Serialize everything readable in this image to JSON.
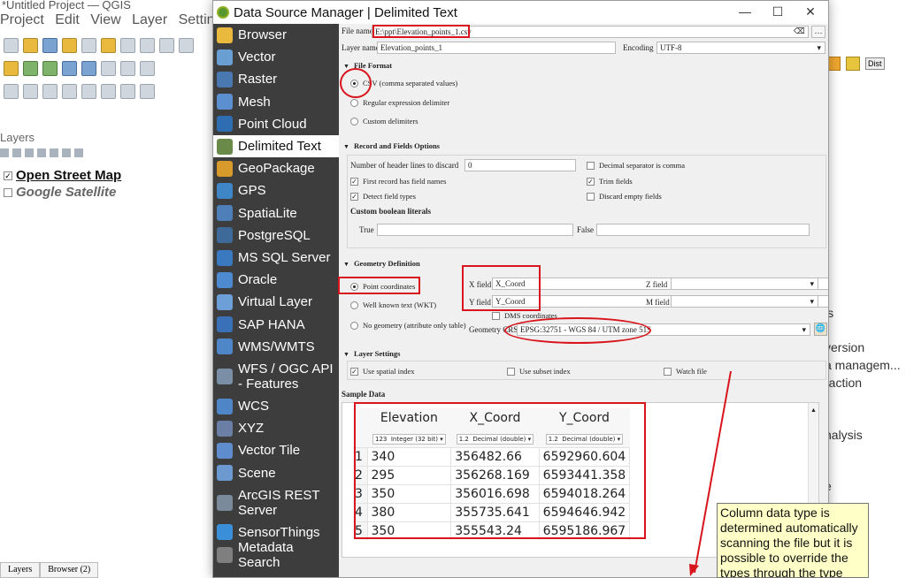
{
  "qgis": {
    "title": "*Untitled Project — QGIS",
    "menu": [
      "Project",
      "Edit",
      "View",
      "Layer",
      "Settings"
    ],
    "layers_panel_title": "Layers",
    "layers": [
      {
        "name": "Open Street Map",
        "checked": true
      },
      {
        "name": "Google Satellite",
        "checked": false
      }
    ],
    "bottom_tabs": [
      "Layers",
      "Browser (2)"
    ],
    "right_fragments": [
      "is",
      "version",
      "a managem...",
      "raction",
      "nalysis",
      "e"
    ],
    "right_toolbar_text": "Dist"
  },
  "dialog": {
    "title": "Data Source Manager | Delimited Text",
    "controls": {
      "minimize": "—",
      "maximize": "☐",
      "close": "✕"
    },
    "sidebar": [
      {
        "label": "Browser",
        "icon": "browser-icon",
        "color": "#e8b93d"
      },
      {
        "label": "Vector",
        "icon": "vector-icon",
        "color": "#6a9fd4"
      },
      {
        "label": "Raster",
        "icon": "raster-icon",
        "color": "#4a78b0"
      },
      {
        "label": "Mesh",
        "icon": "mesh-icon",
        "color": "#5b8fcf"
      },
      {
        "label": "Point Cloud",
        "icon": "point-cloud-icon",
        "color": "#2f6db3"
      },
      {
        "label": "Delimited Text",
        "icon": "delimited-text-icon",
        "color": "#6a8a4a"
      },
      {
        "label": "GeoPackage",
        "icon": "geopackage-icon",
        "color": "#d89a2a"
      },
      {
        "label": "GPS",
        "icon": "gps-icon",
        "color": "#3e86c6"
      },
      {
        "label": "SpatiaLite",
        "icon": "spatialite-icon",
        "color": "#4e7fb8"
      },
      {
        "label": "PostgreSQL",
        "icon": "postgresql-icon",
        "color": "#3d6a99"
      },
      {
        "label": "MS SQL Server",
        "icon": "mssql-icon",
        "color": "#3a78c0"
      },
      {
        "label": "Oracle",
        "icon": "oracle-icon",
        "color": "#4d8ad0"
      },
      {
        "label": "Virtual Layer",
        "icon": "virtual-layer-icon",
        "color": "#6c9fd8"
      },
      {
        "label": "SAP HANA",
        "icon": "sap-hana-icon",
        "color": "#3a70b8"
      },
      {
        "label": "WMS/WMTS",
        "icon": "wms-icon",
        "color": "#4e86c8"
      },
      {
        "label": "WFS / OGC API - Features",
        "icon": "wfs-icon",
        "color": "#7a8fa6"
      },
      {
        "label": "WCS",
        "icon": "wcs-icon",
        "color": "#4e86c8"
      },
      {
        "label": "XYZ",
        "icon": "xyz-icon",
        "color": "#6b7fa6"
      },
      {
        "label": "Vector Tile",
        "icon": "vector-tile-icon",
        "color": "#5f8ccc"
      },
      {
        "label": "Scene",
        "icon": "scene-icon",
        "color": "#6c9ad0"
      },
      {
        "label": "ArcGIS REST Server",
        "icon": "arcgis-icon",
        "color": "#7a8a9a"
      },
      {
        "label": "SensorThings",
        "icon": "sensorthings-icon",
        "color": "#3b8fd8"
      },
      {
        "label": "Metadata Search",
        "icon": "metadata-search-icon",
        "color": "#7f7f7f"
      }
    ],
    "file_name_label": "File name",
    "file_name_value": "E:\\ppt\\Elevation_points_1.csv",
    "browse_label": "…",
    "layer_name_label": "Layer name",
    "layer_name_value": "Elevation_points_1",
    "encoding_label": "Encoding",
    "encoding_value": "UTF-8",
    "file_format": {
      "title": "File Format",
      "options": [
        "CSV (comma separated values)",
        "Regular expression delimiter",
        "Custom delimiters"
      ],
      "selected": 0
    },
    "record_fields": {
      "title": "Record and Fields Options",
      "header_lines_label": "Number of header lines to discard",
      "header_lines_value": "0",
      "decimal_comma_label": "Decimal separator is comma",
      "first_record_label": "First record has field names",
      "trim_fields_label": "Trim fields",
      "detect_types_label": "Detect field types",
      "discard_empty_label": "Discard empty fields",
      "custom_boolean_label": "Custom boolean literals",
      "true_label": "True",
      "false_label": "False"
    },
    "geometry": {
      "title": "Geometry Definition",
      "options": [
        "Point coordinates",
        "Well known text (WKT)",
        "No geometry (attribute only table)"
      ],
      "selected": 0,
      "x_field_label": "X field",
      "x_field_value": "X_Coord",
      "y_field_label": "Y field",
      "y_field_value": "Y_Coord",
      "z_field_label": "Z field",
      "m_field_label": "M field",
      "dms_label": "DMS coordinates",
      "crs_label": "Geometry CRS",
      "crs_value": "EPSG:32751 - WGS 84 / UTM zone 51S"
    },
    "layer_settings": {
      "title": "Layer Settings",
      "spatial_index_label": "Use spatial index",
      "subset_index_label": "Use subset index",
      "watch_file_label": "Watch file"
    },
    "sample": {
      "title": "Sample Data",
      "columns": [
        {
          "name": "Elevation",
          "type": "Integer (32 bit)",
          "type_prefix": "123"
        },
        {
          "name": "X_Coord",
          "type": "Decimal (double)",
          "type_prefix": "1.2"
        },
        {
          "name": "Y_Coord",
          "type": "Decimal (double)",
          "type_prefix": "1.2"
        }
      ],
      "rows": [
        [
          "1",
          "340",
          "356482.66",
          "6592960.604"
        ],
        [
          "2",
          "295",
          "356268.169",
          "6593441.358"
        ],
        [
          "3",
          "350",
          "356016.698",
          "6594018.264"
        ],
        [
          "4",
          "380",
          "355735.641",
          "6594646.942"
        ],
        [
          "5",
          "350",
          "355543.24",
          "6595186.967"
        ]
      ]
    },
    "callout": "Column data type is determined automatically scanning the file but it is possible to override the types through the type"
  }
}
